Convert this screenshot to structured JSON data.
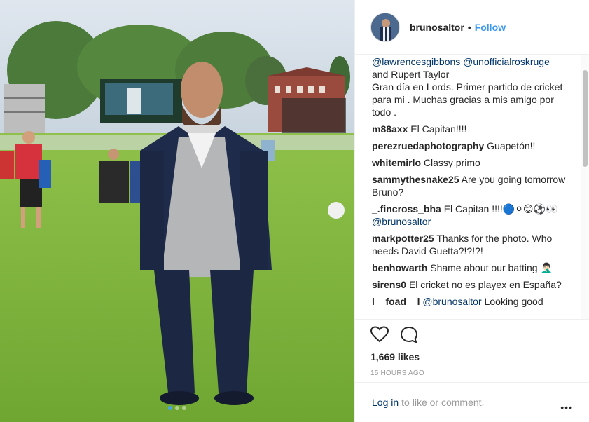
{
  "post": {
    "username": "brunosaltor",
    "separator": "•",
    "follow_label": "Follow"
  },
  "caption": {
    "mention1": "@lawrencesgibbons",
    "mention2": "@unofficialroskruge",
    "text1": "and Rupert Taylor",
    "text2": "Gran día en Lords. Primer partido de cricket para mi . Muchas gracias a mis amigo por todo ."
  },
  "comments": [
    {
      "user": "m88axx",
      "text": "El Capitan!!!!"
    },
    {
      "user": "perezruedaphotography",
      "text": "Guapetón!!"
    },
    {
      "user": "whitemirlo",
      "text": "Classy primo"
    },
    {
      "user": "sammythesnake25",
      "text": "Are you going tomorrow Bruno?"
    },
    {
      "user": "_.fincross_bha",
      "text": "El Capitan !!!!🔵⚪😊⚽👀",
      "mention": "@brunosaltor"
    },
    {
      "user": "markpotter25",
      "text": "Thanks for the photo. Who needs David Guetta?!?!?!"
    },
    {
      "user": "benhowarth",
      "text": "Shame about our batting 🤦🏻‍♂️"
    },
    {
      "user": "sirens0",
      "text": "El cricket no es playex en España?"
    },
    {
      "user": "l__foad__l",
      "mention": "@brunosaltor",
      "text": "Looking good"
    }
  ],
  "stats": {
    "likes": "1,669 likes",
    "time": "15 HOURS AGO"
  },
  "footer": {
    "login": "Log in",
    "rest": "to like or comment.",
    "more": "•••"
  },
  "icons": {
    "like": "heart-icon",
    "comment": "comment-icon",
    "more": "more-options-icon"
  },
  "colors": {
    "link_blue": "#3897f0",
    "mention_blue": "#003569",
    "grass": "#7fb33a",
    "suit": "#1f2b4a"
  },
  "carousel": {
    "count": 3,
    "active": 1
  }
}
